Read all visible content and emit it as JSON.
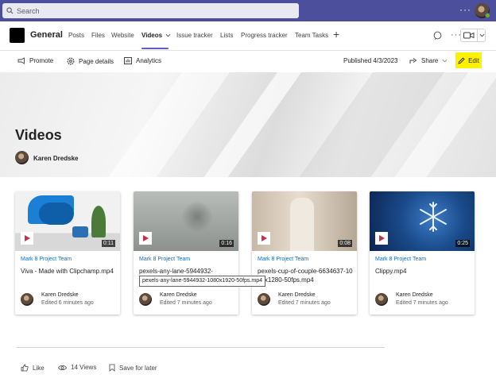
{
  "search": {
    "placeholder": "Search"
  },
  "channel": {
    "name": "General",
    "tabs": [
      {
        "label": "Posts"
      },
      {
        "label": "Files"
      },
      {
        "label": "Website"
      },
      {
        "label": "Videos",
        "active": true
      },
      {
        "label": "Issue tracker"
      },
      {
        "label": "Lists"
      },
      {
        "label": "Progress tracker"
      },
      {
        "label": "Team Tasks"
      }
    ]
  },
  "commands": {
    "promote": "Promote",
    "page_details": "Page details",
    "analytics": "Analytics",
    "published": "Published 4/3/2023",
    "share": "Share",
    "edit": "Edit"
  },
  "page": {
    "title": "Videos",
    "author": "Karen Dredske"
  },
  "videos": [
    {
      "team": "Mark 8 Project Team",
      "title": "Viva - Made with Clipchamp.mp4",
      "duration": "0:11",
      "author": "Karen Dredske",
      "edited": "Edited 6 minutes ago"
    },
    {
      "team": "Mark 8 Project Team",
      "title": "pexels-any-lane-5944932-",
      "duration": "0:16",
      "author": "Karen Dredske",
      "edited": "Edited 7 minutes ago"
    },
    {
      "team": "Mark 8 Project Team",
      "title": "pexels-cup-of-couple-6634637-1080x1280-50fps.mp4",
      "duration": "0:08",
      "author": "Karen Dredske",
      "edited": "Edited 7 minutes ago"
    },
    {
      "team": "Mark 8 Project Team",
      "title": "Clippy.mp4",
      "duration": "0:25",
      "author": "Karen Dredske",
      "edited": "Edited 7 minutes ago"
    }
  ],
  "tooltip": "pexels-any-lane-5944932-1080x1920-50fps.mp4",
  "footer": {
    "like": "Like",
    "views": "14 Views",
    "save": "Save for later"
  },
  "colors": {
    "top_bar": "#4b4f9c",
    "accent": "#5b5fc7",
    "link": "#0f6cbd",
    "highlight": "#fff200",
    "teal_marker": "#00727d"
  }
}
